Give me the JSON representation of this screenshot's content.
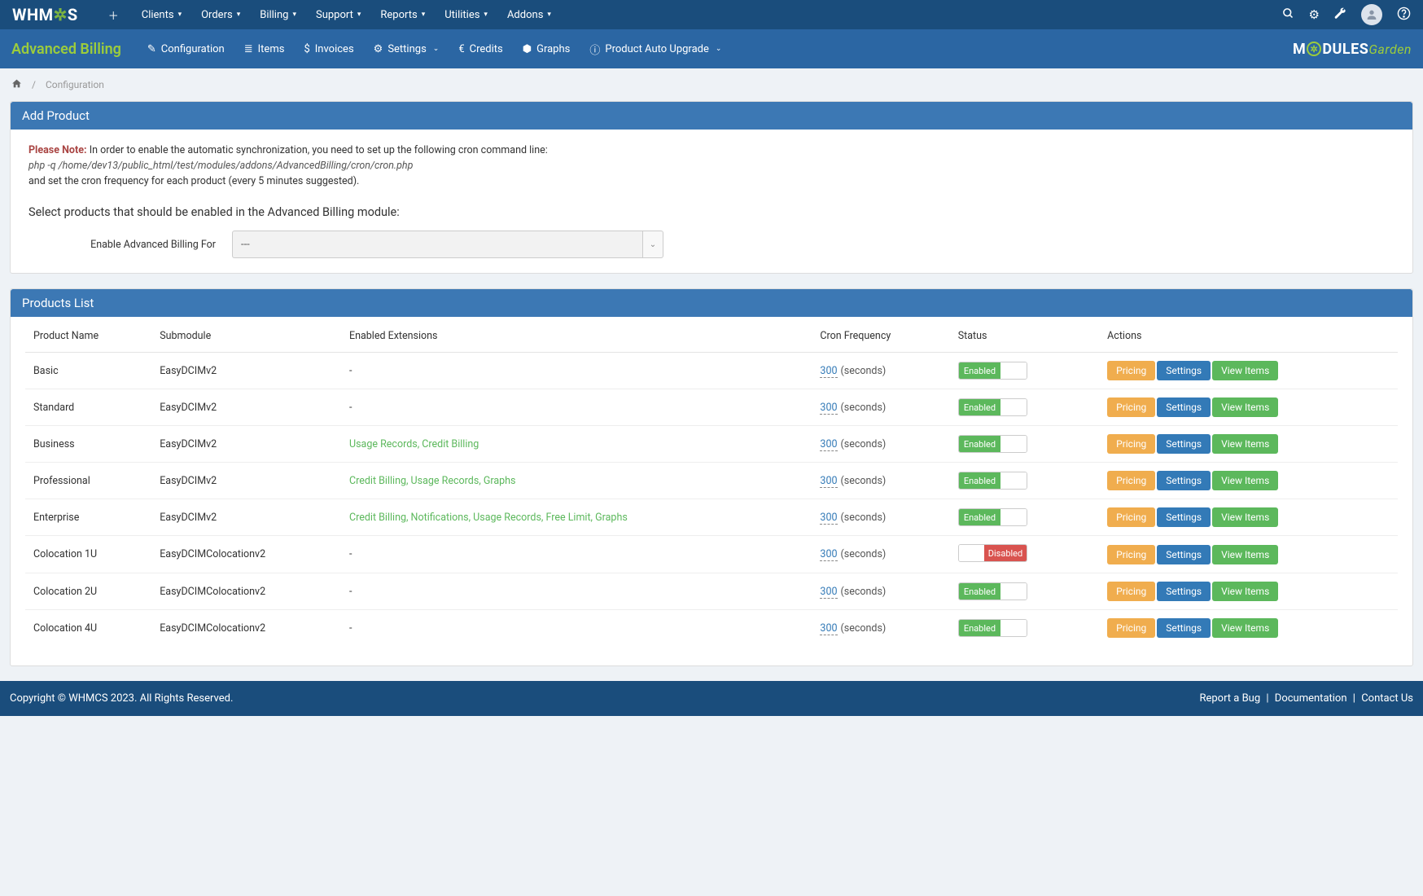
{
  "topnav": {
    "logo_pre": "WHM",
    "logo_post": "S",
    "items": [
      "Clients",
      "Orders",
      "Billing",
      "Support",
      "Reports",
      "Utilities",
      "Addons"
    ]
  },
  "subnav": {
    "title": "Advanced Billing",
    "items": [
      {
        "icon": "✎",
        "label": "Configuration",
        "dropdown": false
      },
      {
        "icon": "≣",
        "label": "Items",
        "dropdown": false
      },
      {
        "icon": "$",
        "label": "Invoices",
        "dropdown": false
      },
      {
        "icon": "⚙",
        "label": "Settings",
        "dropdown": true
      },
      {
        "icon": "€",
        "label": "Credits",
        "dropdown": false
      },
      {
        "icon": "⬢",
        "label": "Graphs",
        "dropdown": false
      },
      {
        "icon": "ⓘ",
        "label": "Product Auto Upgrade",
        "dropdown": true
      }
    ],
    "mg_logo_pre": "M",
    "mg_logo_mid": "DULES",
    "mg_logo_post": "Garden"
  },
  "breadcrumb": {
    "current": "Configuration"
  },
  "panel_add": {
    "heading": "Add Product",
    "note_label": "Please Note:",
    "note_text": "In order to enable the automatic synchronization, you need to set up the following cron command line:",
    "cron_path": "php -q /home/dev13/public_html/test/modules/addons/AdvancedBilling/cron/cron.php",
    "cron_after": "and set the cron frequency for each product (every 5 minutes suggested).",
    "select_products_text": "Select products that should be enabled in the Advanced Billing module:",
    "enable_label": "Enable Advanced Billing For",
    "select_value": "---"
  },
  "panel_list": {
    "heading": "Products List",
    "columns": {
      "name": "Product Name",
      "sub": "Submodule",
      "ext": "Enabled Extensions",
      "cron": "Cron Frequency",
      "status": "Status",
      "actions": "Actions"
    },
    "cron_unit": "(seconds)",
    "status_enabled": "Enabled",
    "status_disabled": "Disabled",
    "btn_pricing": "Pricing",
    "btn_settings": "Settings",
    "btn_view": "View Items",
    "rows": [
      {
        "name": "Basic",
        "sub": "EasyDCIMv2",
        "ext": "-",
        "cron": "300",
        "enabled": true
      },
      {
        "name": "Standard",
        "sub": "EasyDCIMv2",
        "ext": "-",
        "cron": "300",
        "enabled": true
      },
      {
        "name": "Business",
        "sub": "EasyDCIMv2",
        "ext": "Usage Records, Credit Billing",
        "cron": "300",
        "enabled": true
      },
      {
        "name": "Professional",
        "sub": "EasyDCIMv2",
        "ext": "Credit Billing, Usage Records, Graphs",
        "cron": "300",
        "enabled": true
      },
      {
        "name": "Enterprise",
        "sub": "EasyDCIMv2",
        "ext": "Credit Billing, Notifications, Usage Records, Free Limit, Graphs",
        "cron": "300",
        "enabled": true
      },
      {
        "name": "Colocation 1U",
        "sub": "EasyDCIMColocationv2",
        "ext": "-",
        "cron": "300",
        "enabled": false
      },
      {
        "name": "Colocation 2U",
        "sub": "EasyDCIMColocationv2",
        "ext": "-",
        "cron": "300",
        "enabled": true
      },
      {
        "name": "Colocation 4U",
        "sub": "EasyDCIMColocationv2",
        "ext": "-",
        "cron": "300",
        "enabled": true
      }
    ]
  },
  "footer": {
    "copyright": "Copyright © WHMCS 2023. All Rights Reserved.",
    "links": [
      "Report a Bug",
      "Documentation",
      "Contact Us"
    ]
  }
}
